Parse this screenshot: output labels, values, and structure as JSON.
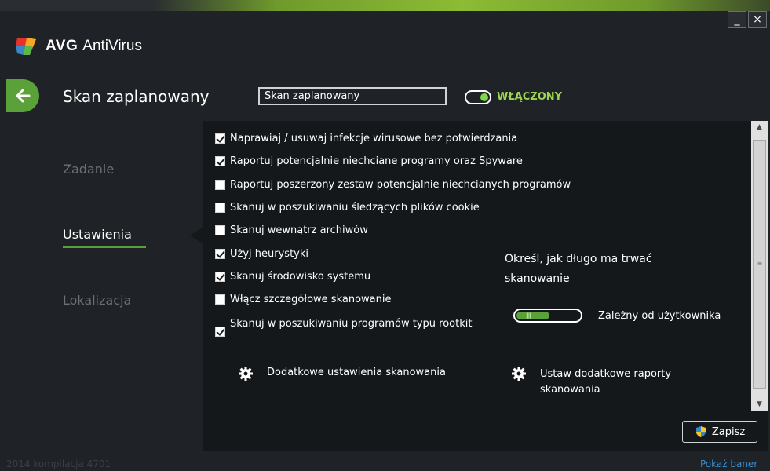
{
  "app": {
    "brand": "AVG",
    "product": "AntiVirus",
    "minimize_label": "_",
    "close_label": "×"
  },
  "header": {
    "title": "Skan zaplanowany",
    "name_value": "Skan zaplanowany",
    "toggle_state": "WŁĄCZONY",
    "toggle_on": true
  },
  "nav": {
    "items": [
      {
        "label": "Zadanie",
        "active": false
      },
      {
        "label": "Ustawienia",
        "active": true
      },
      {
        "label": "Lokalizacja",
        "active": false
      }
    ]
  },
  "settings": {
    "checkboxes": [
      {
        "label": "Naprawiaj / usuwaj infekcje wirusowe bez potwierdzania",
        "checked": true
      },
      {
        "label": "Raportuj potencjalnie niechciane programy oraz Spyware",
        "checked": true
      },
      {
        "label": "Raportuj poszerzony zestaw potencjalnie niechcianych programów",
        "checked": false
      },
      {
        "label": "Skanuj w poszukiwaniu śledzących plików cookie",
        "checked": false
      },
      {
        "label": "Skanuj wewnątrz archiwów",
        "checked": false
      },
      {
        "label": "Użyj heurystyki",
        "checked": true
      },
      {
        "label": "Skanuj środowisko systemu",
        "checked": true
      },
      {
        "label": "Włącz szczegółowe skanowanie",
        "checked": false
      },
      {
        "label": "Skanuj w poszukiwaniu programów typu rootkit",
        "checked": true
      }
    ],
    "duration_heading": "Określ, jak długo ma trwać skanowanie",
    "duration_value": "Zależny od użytkownika",
    "additional_scan_settings": "Dodatkowe ustawienia skanowania",
    "additional_reports": "Ustaw dodatkowe raporty skanowania",
    "save_label": "Zapisz"
  },
  "footer": {
    "build": "2014  kompilacja 4701",
    "show_banner": "Pokaż baner"
  },
  "colors": {
    "accent_green": "#5aa13a",
    "toggle_text": "#9bd450",
    "link_blue": "#3a8fd6",
    "background": "#1f2226",
    "panel": "#15181b"
  }
}
